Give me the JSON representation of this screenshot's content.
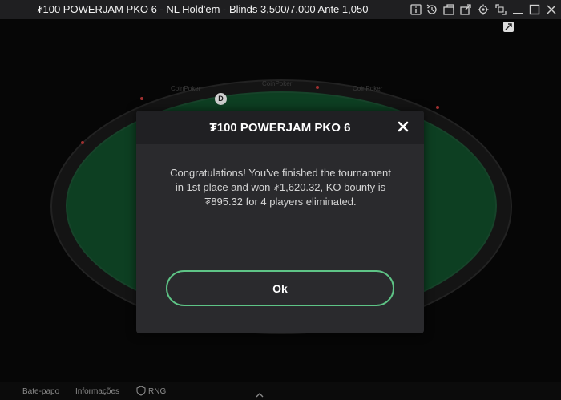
{
  "window": {
    "title": "₮100 POWERJAM PKO 6 - NL Hold'em - Blinds 3,500/7,000 Ante 1,050"
  },
  "table": {
    "dealer_button": "D",
    "rail_brand": "CoinPoker"
  },
  "modal": {
    "title": "₮100 POWERJAM PKO 6",
    "message": "Congratulations! You've finished the tournament in 1st place and won ₮1,620.32, KO bounty is ₮895.32 for 4 players eliminated.",
    "ok_label": "Ok"
  },
  "bottom_bar": {
    "chat_label": "Bate-papo",
    "info_label": "Informações",
    "rng_label": "RNG"
  },
  "colors": {
    "ok_border": "#5ec486",
    "felt": "#0d3f22",
    "modal_bg": "#2a2a2d"
  }
}
